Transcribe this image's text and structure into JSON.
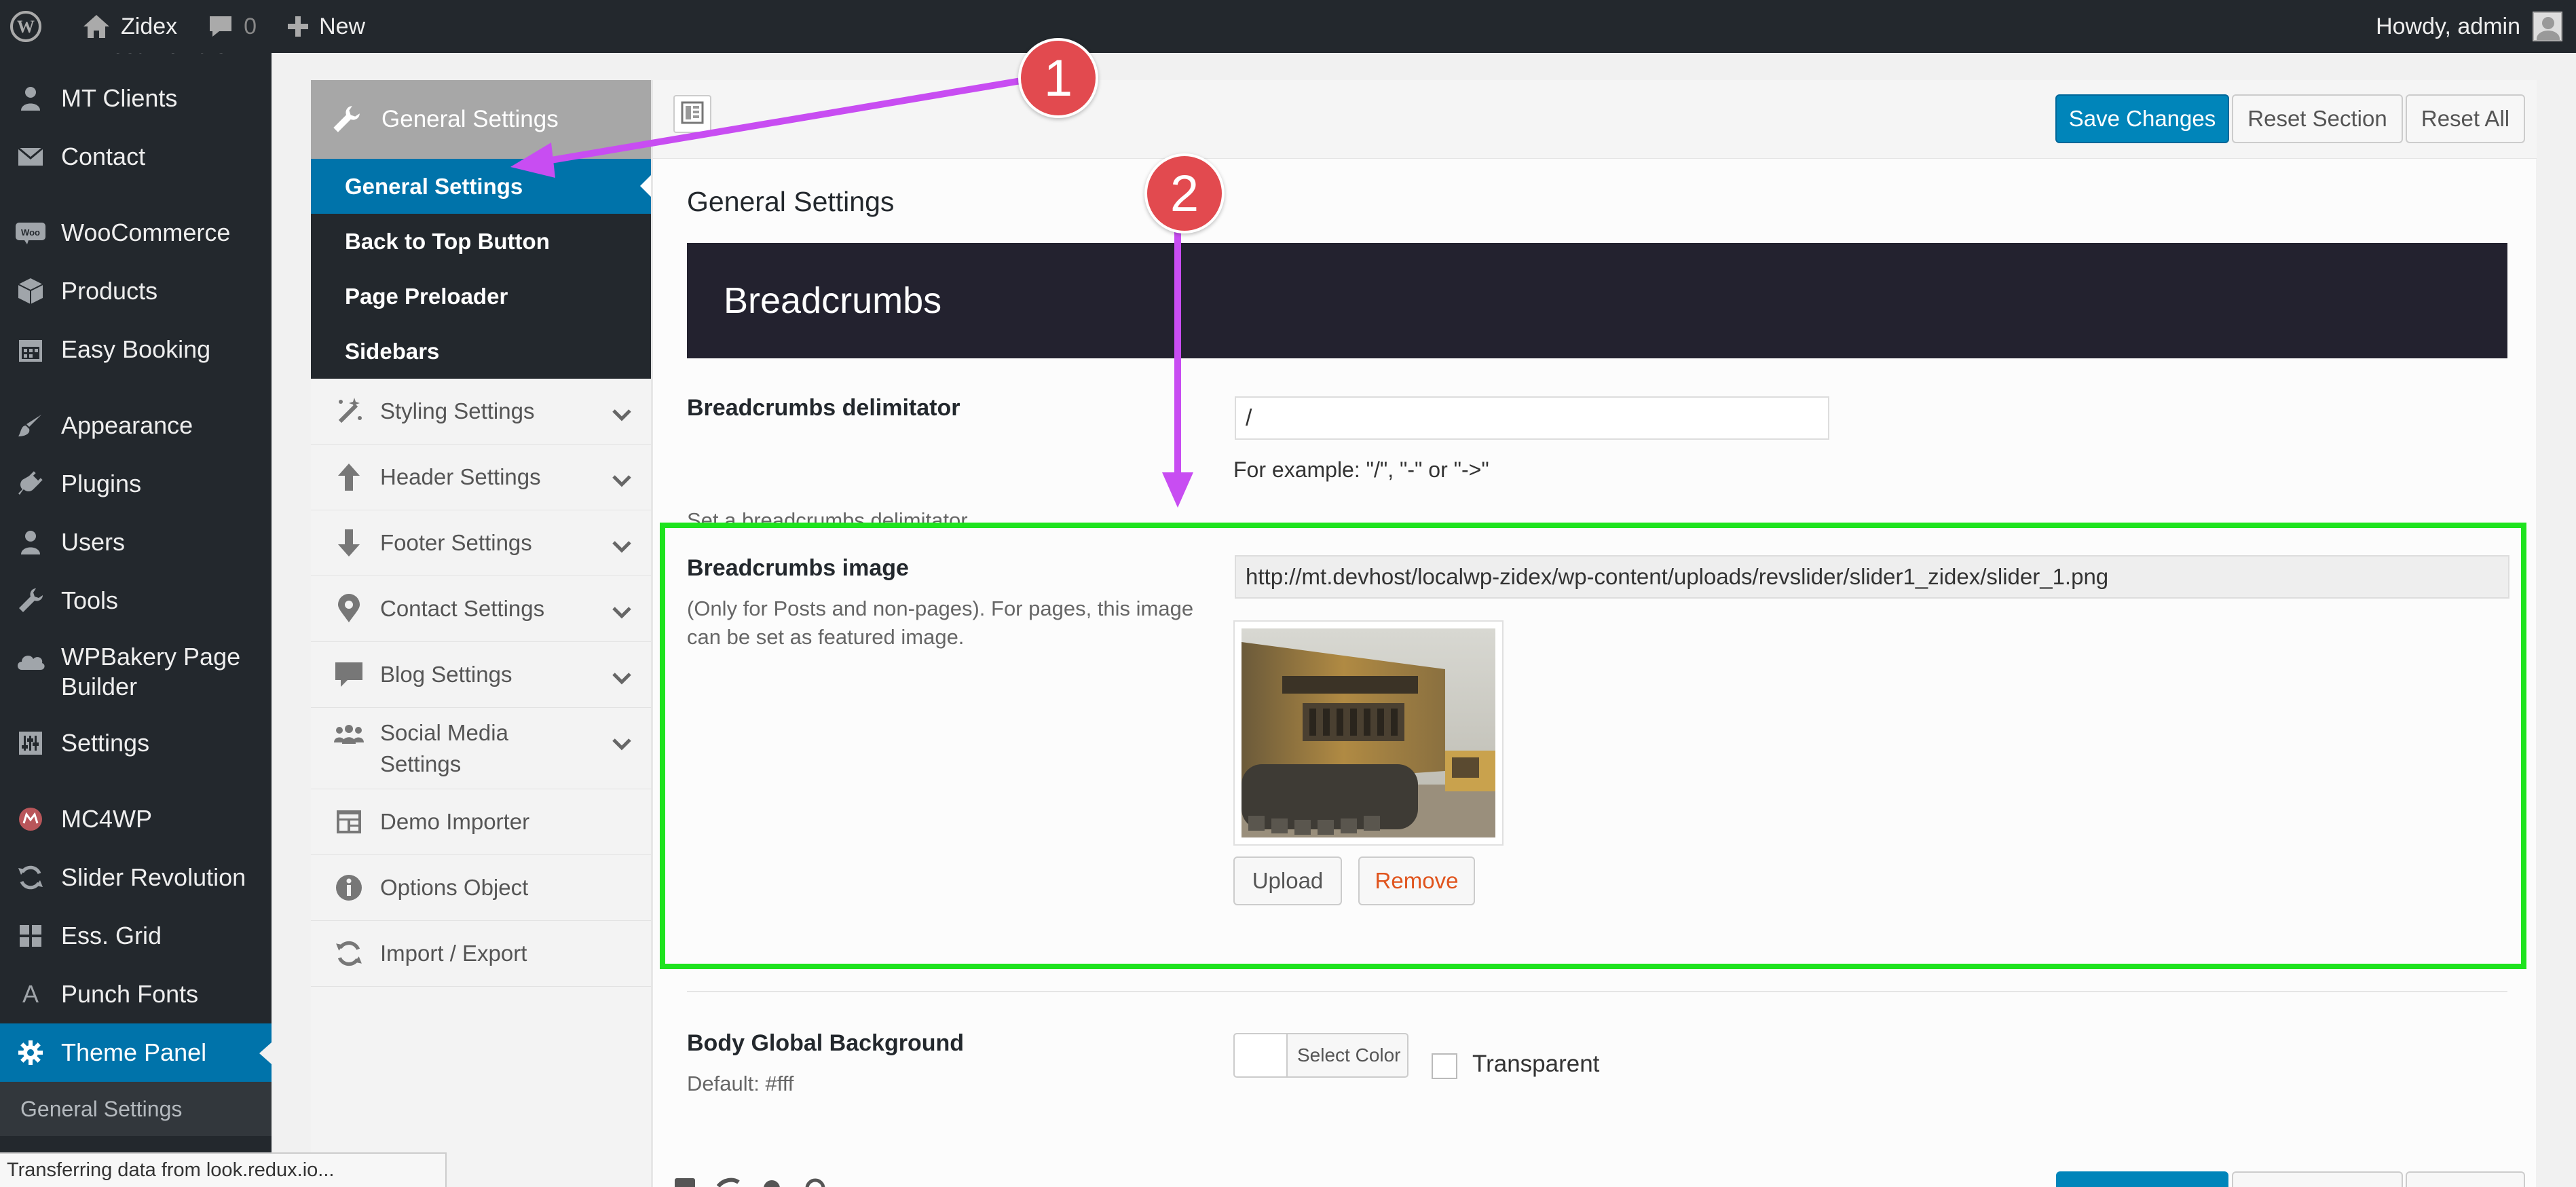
{
  "adminbar": {
    "site_name": "Zidex",
    "comments_count": "0",
    "new_label": "New",
    "howdy": "Howdy, admin"
  },
  "menu": {
    "items": [
      {
        "label": "MT Clients",
        "icon": "person-icon"
      },
      {
        "label": "Contact",
        "icon": "envelope-icon"
      },
      {
        "label": "WooCommerce",
        "icon": "woo-icon"
      },
      {
        "label": "Products",
        "icon": "box-icon"
      },
      {
        "label": "Easy Booking",
        "icon": "calendar-icon"
      },
      {
        "label": "Appearance",
        "icon": "brush-icon"
      },
      {
        "label": "Plugins",
        "icon": "plug-icon"
      },
      {
        "label": "Users",
        "icon": "person-icon"
      },
      {
        "label": "Tools",
        "icon": "wrench-icon"
      },
      {
        "label": "WPBakery Page Builder",
        "icon": "cloud-icon"
      },
      {
        "label": "Settings",
        "icon": "sliders-icon"
      },
      {
        "label": "MC4WP",
        "icon": "mc4wp-icon"
      },
      {
        "label": "Slider Revolution",
        "icon": "refresh-icon"
      },
      {
        "label": "Ess. Grid",
        "icon": "grid-icon"
      },
      {
        "label": "Punch Fonts",
        "icon": "font-a-icon"
      },
      {
        "label": "Theme Panel",
        "icon": "gear-icon"
      }
    ],
    "submenu_title": "General Settings"
  },
  "redux": {
    "active_section": "General Settings",
    "sub_items": [
      "General Settings",
      "Back to Top Button",
      "Page Preloader",
      "Sidebars"
    ],
    "sections": [
      {
        "label": "Styling Settings",
        "icon": "magic-wand-icon",
        "chevron": true
      },
      {
        "label": "Header Settings",
        "icon": "arrow-up-icon",
        "chevron": true
      },
      {
        "label": "Footer Settings",
        "icon": "arrow-down-icon",
        "chevron": true
      },
      {
        "label": "Contact Settings",
        "icon": "map-pin-icon",
        "chevron": true
      },
      {
        "label": "Blog Settings",
        "icon": "speech-bubble-icon",
        "chevron": true
      },
      {
        "label": "Social Media Settings",
        "icon": "group-icon",
        "chevron": true
      },
      {
        "label": "Demo Importer",
        "icon": "layout-icon",
        "chevron": false
      },
      {
        "label": "Options Object",
        "icon": "info-icon",
        "chevron": false
      },
      {
        "label": "Import / Export",
        "icon": "refresh-icon",
        "chevron": false
      }
    ],
    "buttons": {
      "save": "Save Changes",
      "reset_section": "Reset Section",
      "reset_all": "Reset All"
    }
  },
  "main": {
    "section_title": "General Settings",
    "banner": "Breadcrumbs",
    "delimiter": {
      "label": "Breadcrumbs delimitator",
      "desc": "Set a breadcrumbs delimitator.",
      "value": "/",
      "hint": "For example: \"/\", \"-\" or \"->\""
    },
    "image": {
      "label": "Breadcrumbs image",
      "desc_line1": "(Only for Posts and non-pages). For pages, this image",
      "desc_line2": "can be set as featured image.",
      "url": "http://mt.devhost/localwp-zidex/wp-content/uploads/revslider/slider1_zidex/slider_1.png",
      "upload": "Upload",
      "remove": "Remove"
    },
    "background": {
      "label": "Body Global Background",
      "desc": "Default: #fff",
      "select_color": "Select Color",
      "transparent": "Transparent"
    }
  },
  "annotations": {
    "badge1": "1",
    "badge2": "2",
    "arrow_color": "#c84df2",
    "box_color": "#1ee31e"
  },
  "status": "Transferring data from look.redux.io..."
}
